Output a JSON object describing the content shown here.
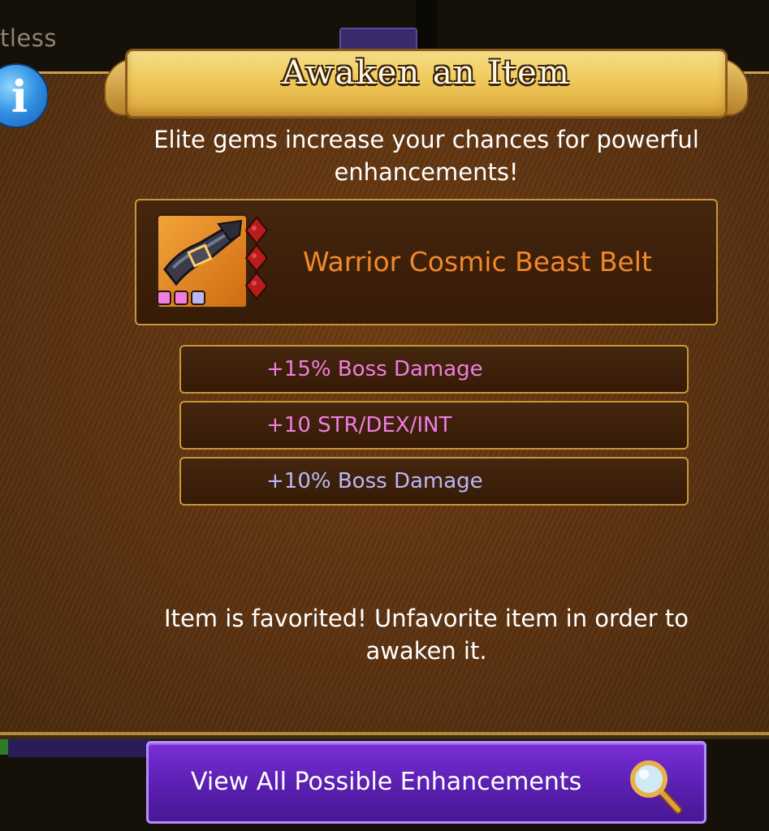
{
  "background": {
    "left_partial_text": "tless"
  },
  "dialog": {
    "title": "Awaken an Item",
    "subtitle": "Elite gems increase your chances for powerful enhancements!",
    "item": {
      "name": "Warrior Cosmic Beast Belt",
      "icon": "belt-icon",
      "gem_colors": [
        "#f07ee0",
        "#f07ee0",
        "#b9b8f7"
      ],
      "socket_color": "#b81c1c"
    },
    "enhancements": [
      {
        "text": "+15% Boss Damage",
        "color": "#f07ee0"
      },
      {
        "text": "+10 STR/DEX/INT",
        "color": "#f07ee0"
      },
      {
        "text": "+10% Boss Damage",
        "color": "#b9b8f7"
      }
    ],
    "warning": "Item is favorited! Unfavorite item in order to awaken it.",
    "view_button_label": "View All Possible Enhancements",
    "view_button_icon": "magnifier-icon",
    "info_icon_label": "i"
  },
  "colors": {
    "item_name": "#f2882a",
    "title_banner": "#f0c95a",
    "button_purple": "#5a1fb0"
  }
}
